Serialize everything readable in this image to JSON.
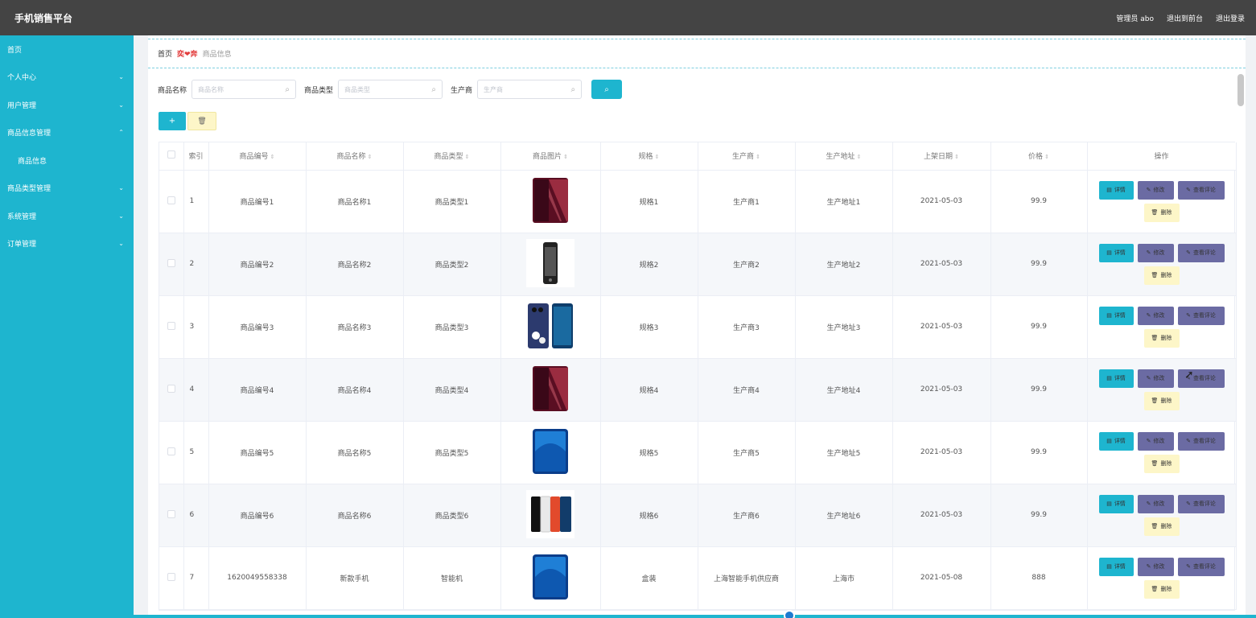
{
  "header": {
    "title": "手机销售平台",
    "admin_label": "管理员 abo",
    "back_label": "退出到前台",
    "logout_label": "退出登录"
  },
  "sidebar": {
    "items": [
      {
        "label": "首页",
        "chevron": ""
      },
      {
        "label": "个人中心",
        "chevron": "⌄"
      },
      {
        "label": "用户管理",
        "chevron": "⌄"
      },
      {
        "label": "商品信息管理",
        "chevron": "⌃"
      },
      {
        "label": "商品信息",
        "chevron": ""
      },
      {
        "label": "商品类型管理",
        "chevron": "⌄"
      },
      {
        "label": "系统管理",
        "chevron": "⌄"
      },
      {
        "label": "订单管理",
        "chevron": "⌄"
      }
    ]
  },
  "breadcrumb": {
    "home": "首页",
    "separator": "奕❤奔",
    "current": "商品信息"
  },
  "search": {
    "name_label": "商品名称",
    "name_placeholder": "商品名称",
    "type_label": "商品类型",
    "type_placeholder": "商品类型",
    "maker_label": "生产商",
    "maker_placeholder": "生产商",
    "search_icon": "search-icon"
  },
  "toolbar": {
    "add_label": "+",
    "delete_icon": "trash-icon",
    "delete_glyph": "🗑"
  },
  "table": {
    "headers": {
      "index": "索引",
      "code": "商品编号",
      "name": "商品名称",
      "type": "商品类型",
      "image": "商品图片",
      "spec": "规格",
      "maker": "生产商",
      "address": "生产地址",
      "date": "上架日期",
      "price": "价格",
      "ops": "操作"
    },
    "sort_glyph": "⇕",
    "buttons": {
      "detail": "详情",
      "edit": "修改",
      "review": "查看评论",
      "remove": "删除"
    },
    "rows": [
      {
        "index": "1",
        "code": "商品编号1",
        "name": "商品名称1",
        "type": "商品类型1",
        "image": "phone-red-icon",
        "spec": "规格1",
        "maker": "生产商1",
        "address": "生产地址1",
        "date": "2021-05-03",
        "price": "99.9"
      },
      {
        "index": "2",
        "code": "商品编号2",
        "name": "商品名称2",
        "type": "商品类型2",
        "image": "phone-black-icon",
        "spec": "规格2",
        "maker": "生产商2",
        "address": "生产地址2",
        "date": "2021-05-03",
        "price": "99.9"
      },
      {
        "index": "3",
        "code": "商品编号3",
        "name": "商品名称3",
        "type": "商品类型3",
        "image": "phone-pair-icon",
        "spec": "规格3",
        "maker": "生产商3",
        "address": "生产地址3",
        "date": "2021-05-03",
        "price": "99.9"
      },
      {
        "index": "4",
        "code": "商品编号4",
        "name": "商品名称4",
        "type": "商品类型4",
        "image": "phone-red-icon",
        "spec": "规格4",
        "maker": "生产商4",
        "address": "生产地址4",
        "date": "2021-05-03",
        "price": "99.9"
      },
      {
        "index": "5",
        "code": "商品编号5",
        "name": "商品名称5",
        "type": "商品类型5",
        "image": "phone-blue-icon",
        "spec": "规格5",
        "maker": "生产商5",
        "address": "生产地址5",
        "date": "2021-05-03",
        "price": "99.9"
      },
      {
        "index": "6",
        "code": "商品编号6",
        "name": "商品名称6",
        "type": "商品类型6",
        "image": "phone-set-icon",
        "spec": "规格6",
        "maker": "生产商6",
        "address": "生产地址6",
        "date": "2021-05-03",
        "price": "99.9"
      },
      {
        "index": "7",
        "code": "1620049558338",
        "name": "新款手机",
        "type": "智能机",
        "image": "phone-blue-icon",
        "spec": "盒装",
        "maker": "上海智能手机供应商",
        "address": "上海市",
        "date": "2021-05-08",
        "price": "888"
      }
    ]
  },
  "colors": {
    "accent": "#1eb5cf",
    "topbar": "#444444",
    "edit": "#6b6ba3",
    "remove": "#fdf6c8"
  }
}
